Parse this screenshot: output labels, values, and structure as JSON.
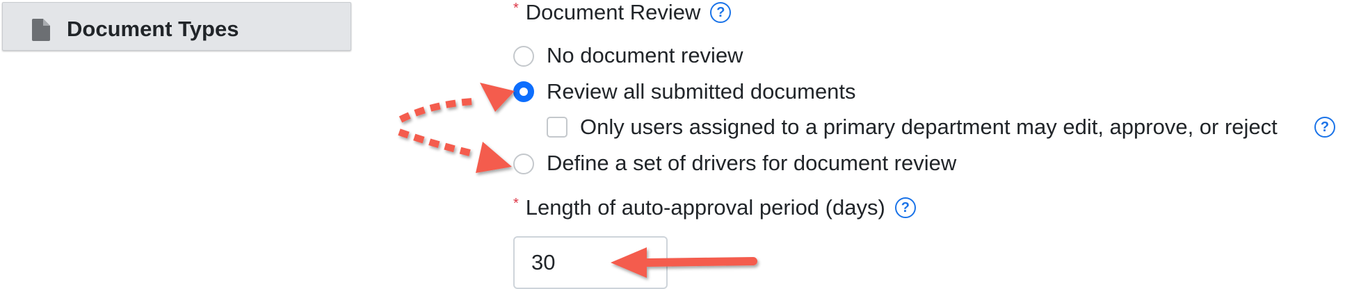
{
  "sidebar": {
    "tab_label": "Document Types",
    "tab_icon": "document-icon"
  },
  "form": {
    "required_marker": "*",
    "help_glyph": "?",
    "document_review": {
      "label": "Document Review",
      "options": [
        {
          "label": "No document review",
          "selected": false
        },
        {
          "label": "Review all submitted documents",
          "selected": true
        },
        {
          "label": "Define a set of drivers for document review",
          "selected": false
        }
      ],
      "primary_department_checkbox": {
        "label": "Only users assigned to a primary department may edit, approve, or reject",
        "checked": false
      }
    },
    "auto_approval": {
      "label": "Length of auto-approval period (days)",
      "value": "30"
    }
  },
  "colors": {
    "accent": "#0d6efd",
    "required": "#dc3545",
    "annotation_arrow": "#f45b4d",
    "sidebar_bg": "#e3e5e8"
  }
}
